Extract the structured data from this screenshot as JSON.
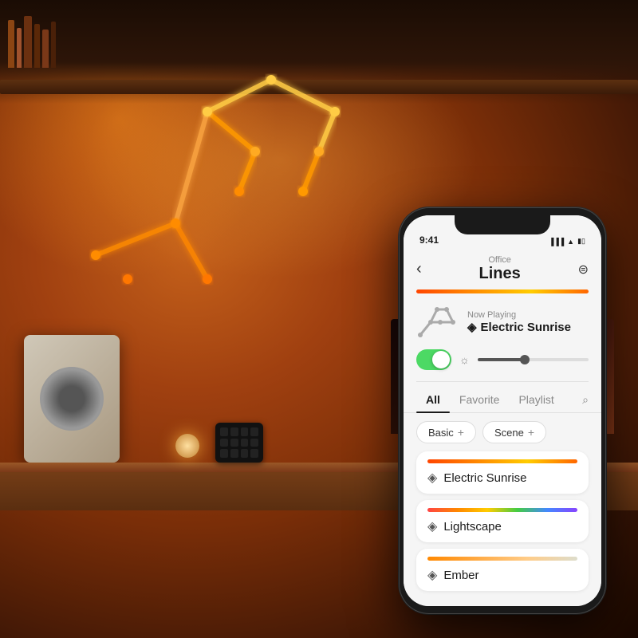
{
  "background": {
    "glow_color": "#c4601a",
    "dark_color": "#1a0800"
  },
  "phone": {
    "status_bar": {
      "time": "9:41",
      "signal": "●●●",
      "wifi": "▲",
      "battery": "▮"
    },
    "header": {
      "back_label": "‹",
      "location": "Office",
      "title": "Lines",
      "settings_icon": "⊕"
    },
    "now_playing": {
      "label": "Now Playing",
      "scene_name": "Electric Sunrise",
      "drop_icon": "◈"
    },
    "controls": {
      "toggle_on": true,
      "brightness_pct": 40
    },
    "tabs": {
      "items": [
        "All",
        "Favorite",
        "Playlist"
      ],
      "active": "All",
      "search_icon": "⌕"
    },
    "filters": [
      {
        "label": "Basic",
        "plus": "+"
      },
      {
        "label": "Scene",
        "plus": "+"
      }
    ],
    "scenes": [
      {
        "id": "electric-sunrise",
        "name": "Electric Sunrise",
        "bar_type": "electric"
      },
      {
        "id": "lightscape",
        "name": "Lightscape",
        "bar_type": "lightscape"
      },
      {
        "id": "ember",
        "name": "Ember",
        "bar_type": "ember"
      }
    ]
  }
}
